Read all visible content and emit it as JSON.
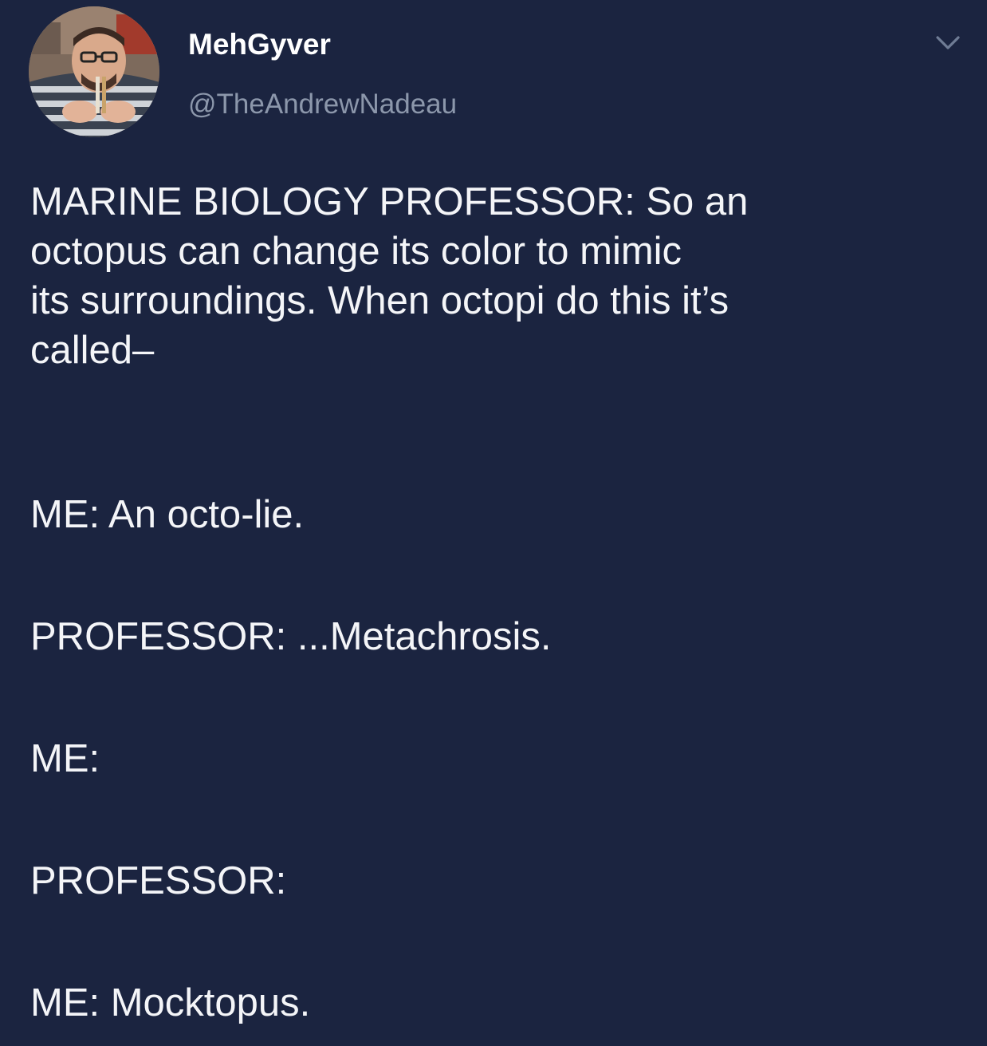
{
  "user": {
    "display_name": "MehGyver",
    "handle": "@TheAndrewNadeau",
    "avatar_icon": "profile-photo",
    "menu_icon": "chevron-down-icon"
  },
  "tweet": {
    "intro_lines": [
      "MARINE BIOLOGY PROFESSOR: So an",
      "octopus can change its color to mimic",
      "its surroundings. When octopi do this it’s",
      "called–"
    ],
    "line_2": "ME: An octo-lie.",
    "line_3": "PROFESSOR: ...Metachrosis.",
    "line_4": "ME:",
    "line_5": "PROFESSOR:",
    "line_6": "ME: Mocktopus."
  },
  "colors": {
    "background": "#1b2440",
    "text": "#f4f5f8",
    "handle": "#8c97ab",
    "chevron": "#6f7c95"
  }
}
